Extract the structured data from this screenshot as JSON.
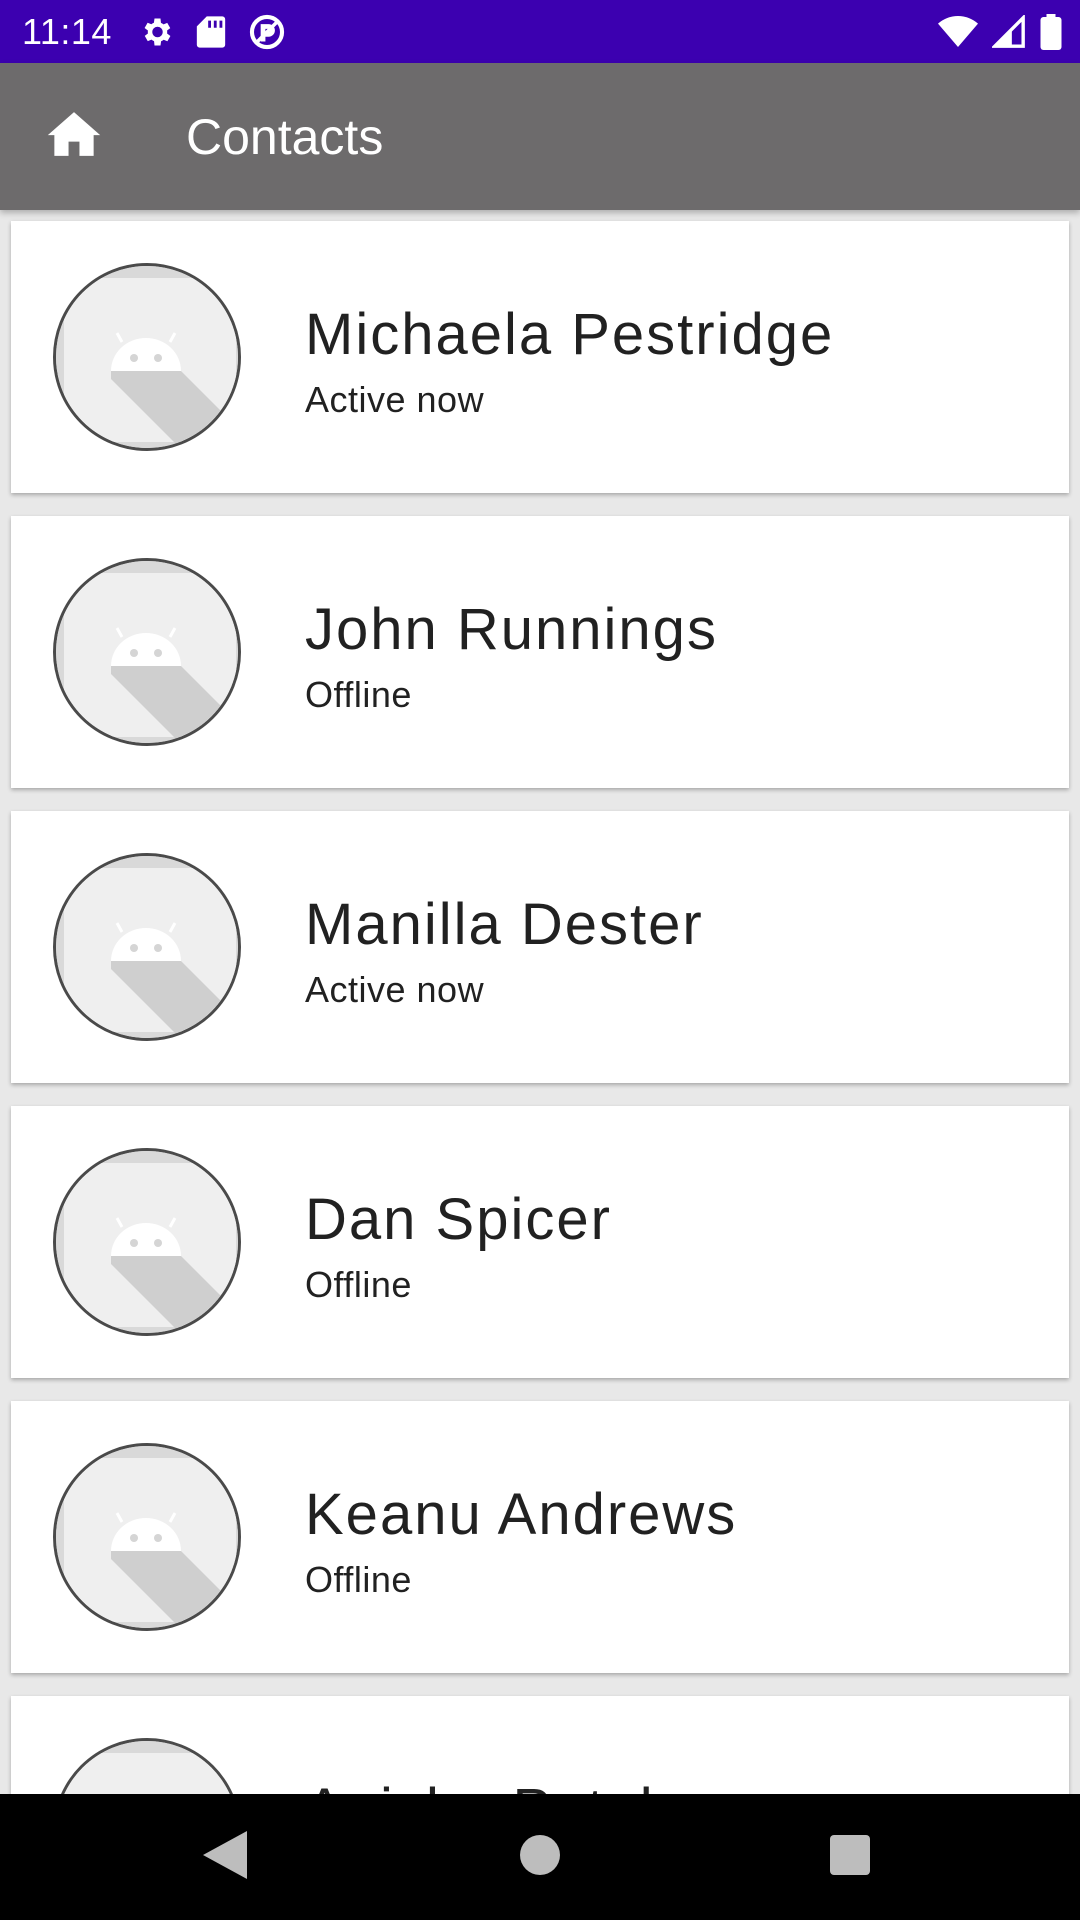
{
  "status_bar": {
    "time": "11:14",
    "icons_left": [
      "settings-icon",
      "sd-card-icon",
      "vpn-icon"
    ],
    "icons_right": [
      "wifi-icon",
      "signal-icon",
      "battery-icon"
    ],
    "background": "#3c00b0"
  },
  "app_bar": {
    "title": "Contacts",
    "home_icon": "home-icon",
    "background": "#6d6b6c"
  },
  "contacts": [
    {
      "name": "Michaela Pestridge",
      "status": "Active now"
    },
    {
      "name": "John Runnings",
      "status": "Offline"
    },
    {
      "name": "Manilla Dester",
      "status": "Active now"
    },
    {
      "name": "Dan Spicer",
      "status": "Offline"
    },
    {
      "name": "Keanu Andrews",
      "status": "Offline"
    },
    {
      "name": "Anisha Patel",
      "status": ""
    }
  ],
  "nav_bar": {
    "buttons": [
      "back-icon",
      "home-circle-icon",
      "recents-icon"
    ]
  }
}
